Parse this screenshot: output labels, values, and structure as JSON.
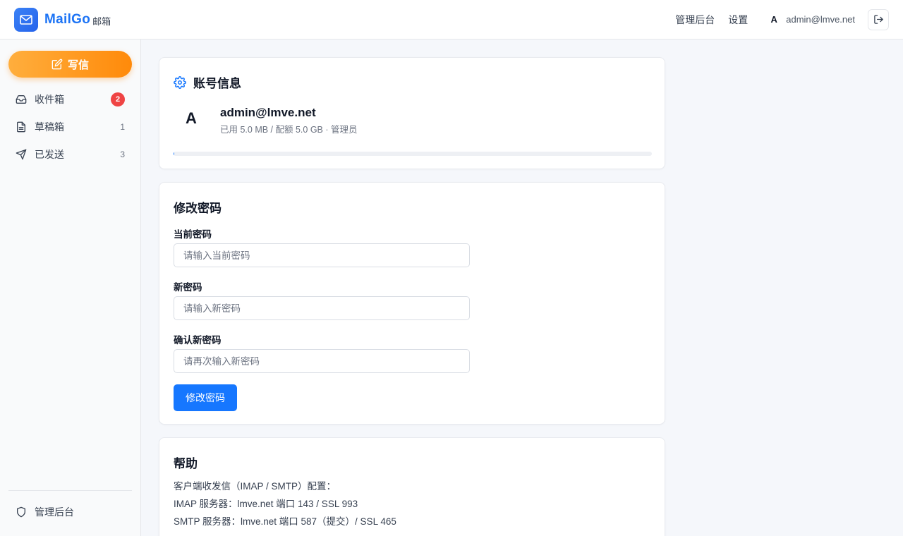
{
  "header": {
    "brand": "MailGo",
    "brand_sub": "邮箱",
    "links": {
      "admin": "管理后台",
      "settings": "设置"
    },
    "user_initial": "A",
    "user_email": "admin@lmve.net"
  },
  "sidebar": {
    "compose_label": "写信",
    "items": [
      {
        "label": "收件箱",
        "badge": "2",
        "icon": "inbox-icon"
      },
      {
        "label": "草稿箱",
        "count": "1",
        "icon": "file-icon"
      },
      {
        "label": "已发送",
        "count": "3",
        "icon": "send-icon"
      }
    ],
    "admin_label": "管理后台"
  },
  "account": {
    "title": "账号信息",
    "avatar_initial": "A",
    "email": "admin@lmve.net",
    "usage": "已用 5.0 MB / 配额 5.0 GB · 管理员",
    "quota_fraction": 0.001
  },
  "password": {
    "title": "修改密码",
    "current_label": "当前密码",
    "current_placeholder": "请输入当前密码",
    "new_label": "新密码",
    "new_placeholder": "请输入新密码",
    "confirm_label": "确认新密码",
    "confirm_placeholder": "请再次输入新密码",
    "submit_label": "修改密码"
  },
  "help": {
    "title": "帮助",
    "lines": [
      "客户端收发信（IMAP / SMTP）配置：",
      "IMAP 服务器：lmve.net 端口 143 / SSL 993",
      "SMTP 服务器：lmve.net 端口 587（提交）/ SSL 465"
    ]
  },
  "colors": {
    "primary": "#1677ff",
    "compose_orange": "#ff8a0a",
    "badge_red": "#ef4444"
  }
}
